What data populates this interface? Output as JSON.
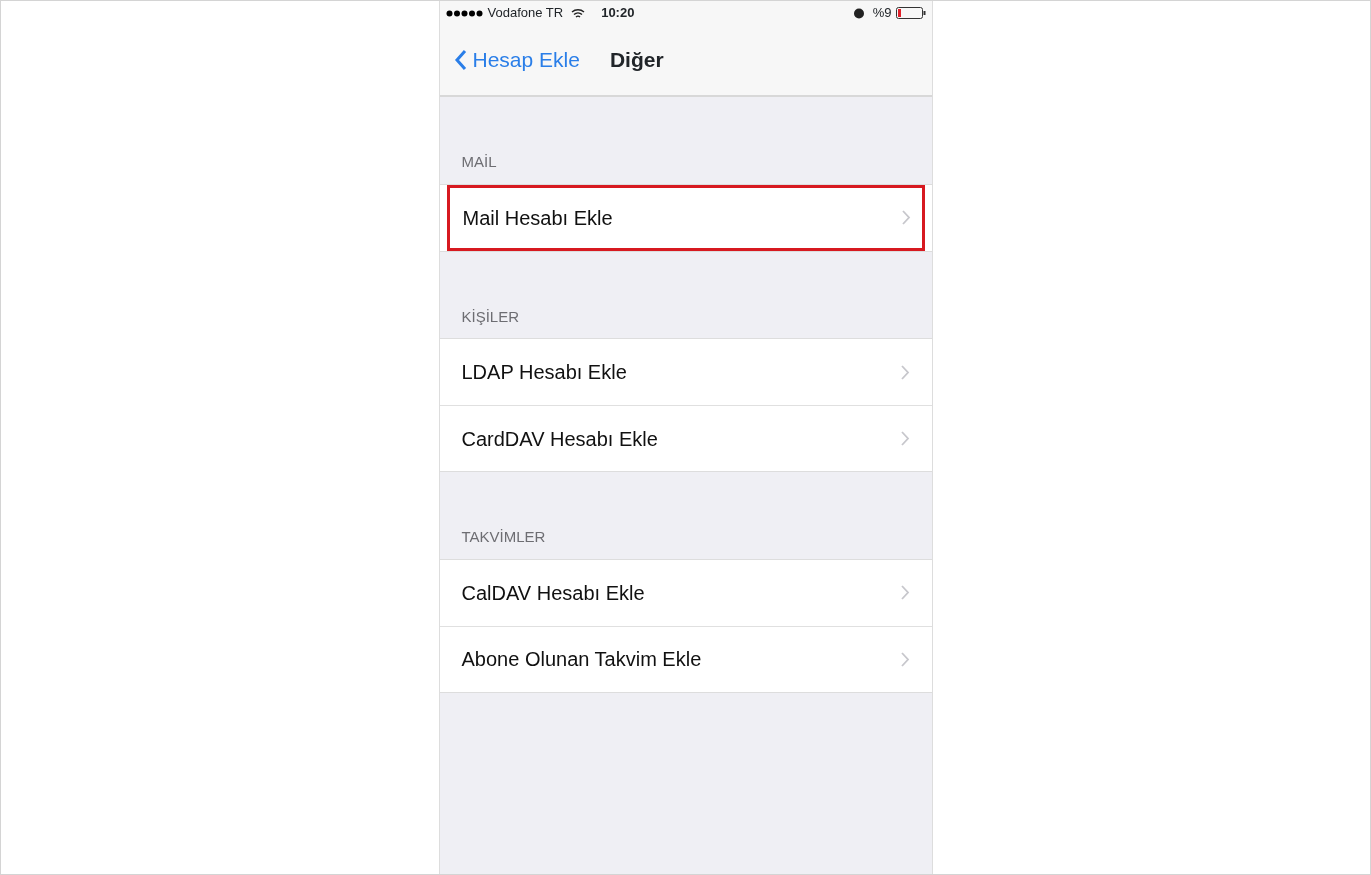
{
  "status_bar": {
    "carrier": "Vodafone TR",
    "time": "10:20",
    "battery": "%9"
  },
  "nav": {
    "back": "Hesap Ekle",
    "title": "Diğer"
  },
  "sections": [
    {
      "header": "MAİL",
      "rows": [
        {
          "label": "Mail Hesabı Ekle",
          "highlighted": true
        }
      ]
    },
    {
      "header": "KİŞİLER",
      "rows": [
        {
          "label": "LDAP Hesabı Ekle",
          "highlighted": false
        },
        {
          "label": "CardDAV Hesabı Ekle",
          "highlighted": false
        }
      ]
    },
    {
      "header": "TAKVİMLER",
      "rows": [
        {
          "label": "CalDAV Hesabı Ekle",
          "highlighted": false
        },
        {
          "label": "Abone Olunan Takvim Ekle",
          "highlighted": false
        }
      ]
    }
  ]
}
